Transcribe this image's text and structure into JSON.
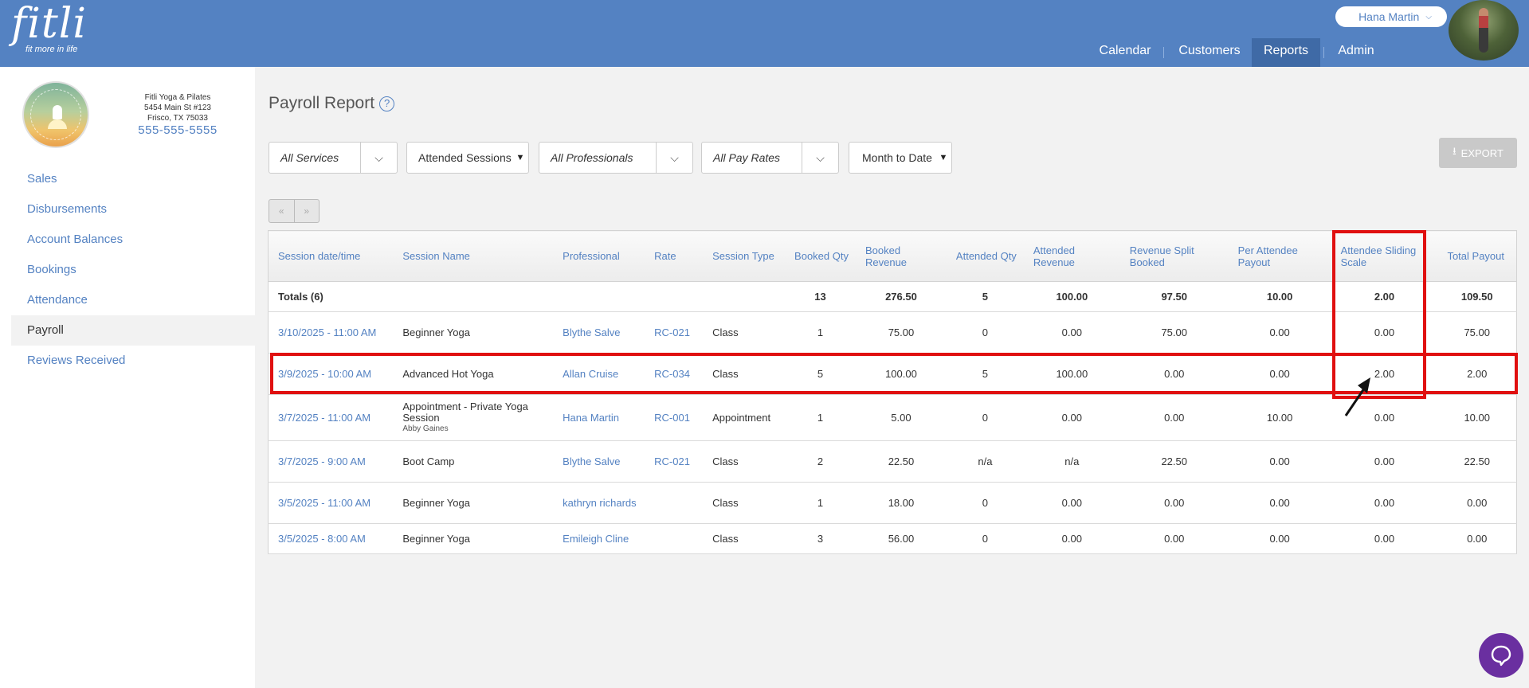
{
  "header": {
    "logo_text": "fitli",
    "logo_tagline": "fit more in life",
    "user_name": "Hana Martin",
    "nav": [
      {
        "label": "Calendar",
        "active": false
      },
      {
        "label": "Customers",
        "active": false
      },
      {
        "label": "Reports",
        "active": true
      },
      {
        "label": "Admin",
        "active": false
      }
    ]
  },
  "studio": {
    "name": "Fitli Yoga & Pilates",
    "address1": "5454 Main St #123",
    "address2": "Frisco, TX 75033",
    "phone": "555-555-5555"
  },
  "sidebar": {
    "items": [
      {
        "label": "Sales"
      },
      {
        "label": "Disbursements"
      },
      {
        "label": "Account Balances"
      },
      {
        "label": "Bookings"
      },
      {
        "label": "Attendance"
      },
      {
        "label": "Payroll",
        "active": true
      },
      {
        "label": "Reviews Received"
      }
    ]
  },
  "page": {
    "title": "Payroll Report",
    "help": "?",
    "export_label": "EXPORT"
  },
  "filters": {
    "services": "All Services",
    "sessions": "Attended Sessions",
    "professionals": "All Professionals",
    "pay_rates": "All Pay Rates",
    "period": "Month to Date"
  },
  "pager": {
    "prev": "«",
    "next": "»"
  },
  "table": {
    "headers": [
      "Session date/time",
      "Session Name",
      "Professional",
      "Rate",
      "Session Type",
      "Booked Qty",
      "Booked Revenue",
      "Attended Qty",
      "Attended Revenue",
      "Revenue Split Booked",
      "Per Attendee Payout",
      "Attendee Sliding Scale",
      "Total Payout"
    ],
    "totals": {
      "label": "Totals (6)",
      "booked_qty": "13",
      "booked_revenue": "276.50",
      "attended_qty": "5",
      "attended_revenue": "100.00",
      "revenue_split": "97.50",
      "per_attendee": "10.00",
      "sliding_scale": "2.00",
      "total_payout": "109.50"
    },
    "rows": [
      {
        "date": "3/10/2025 - 11:00 AM",
        "name": "Beginner Yoga",
        "sub": "",
        "professional": "Blythe Salve",
        "rate": "RC-021",
        "type": "Class",
        "booked_qty": "1",
        "booked_revenue": "75.00",
        "attended_qty": "0",
        "attended_revenue": "0.00",
        "revenue_split": "75.00",
        "per_attendee": "0.00",
        "sliding_scale": "0.00",
        "total_payout": "75.00"
      },
      {
        "date": "3/9/2025 - 10:00 AM",
        "name": "Advanced Hot Yoga",
        "sub": "",
        "professional": "Allan Cruise",
        "rate": "RC-034",
        "type": "Class",
        "booked_qty": "5",
        "booked_revenue": "100.00",
        "attended_qty": "5",
        "attended_revenue": "100.00",
        "revenue_split": "0.00",
        "per_attendee": "0.00",
        "sliding_scale": "2.00",
        "total_payout": "2.00"
      },
      {
        "date": "3/7/2025 - 11:00 AM",
        "name": "Appointment - Private Yoga Session",
        "sub": "Abby Gaines",
        "professional": "Hana Martin",
        "rate": "RC-001",
        "type": "Appointment",
        "booked_qty": "1",
        "booked_revenue": "5.00",
        "attended_qty": "0",
        "attended_revenue": "0.00",
        "revenue_split": "0.00",
        "per_attendee": "10.00",
        "sliding_scale": "0.00",
        "total_payout": "10.00"
      },
      {
        "date": "3/7/2025 - 9:00 AM",
        "name": "Boot Camp",
        "sub": "",
        "professional": "Blythe Salve",
        "rate": "RC-021",
        "type": "Class",
        "booked_qty": "2",
        "booked_revenue": "22.50",
        "attended_qty": "n/a",
        "attended_revenue": "n/a",
        "revenue_split": "22.50",
        "per_attendee": "0.00",
        "sliding_scale": "0.00",
        "total_payout": "22.50"
      },
      {
        "date": "3/5/2025 - 11:00 AM",
        "name": "Beginner Yoga",
        "sub": "",
        "professional": "kathryn richards",
        "rate": "",
        "type": "Class",
        "booked_qty": "1",
        "booked_revenue": "18.00",
        "attended_qty": "0",
        "attended_revenue": "0.00",
        "revenue_split": "0.00",
        "per_attendee": "0.00",
        "sliding_scale": "0.00",
        "total_payout": "0.00"
      },
      {
        "date": "3/5/2025 - 8:00 AM",
        "name": "Beginner Yoga",
        "sub": "",
        "professional": "Emileigh Cline",
        "rate": "",
        "type": "Class",
        "booked_qty": "3",
        "booked_revenue": "56.00",
        "attended_qty": "0",
        "attended_revenue": "0.00",
        "revenue_split": "0.00",
        "per_attendee": "0.00",
        "sliding_scale": "0.00",
        "total_payout": "0.00"
      }
    ]
  },
  "colors": {
    "header": "#5482c2",
    "highlight": "#e01010",
    "chat": "#6a2fa0"
  }
}
